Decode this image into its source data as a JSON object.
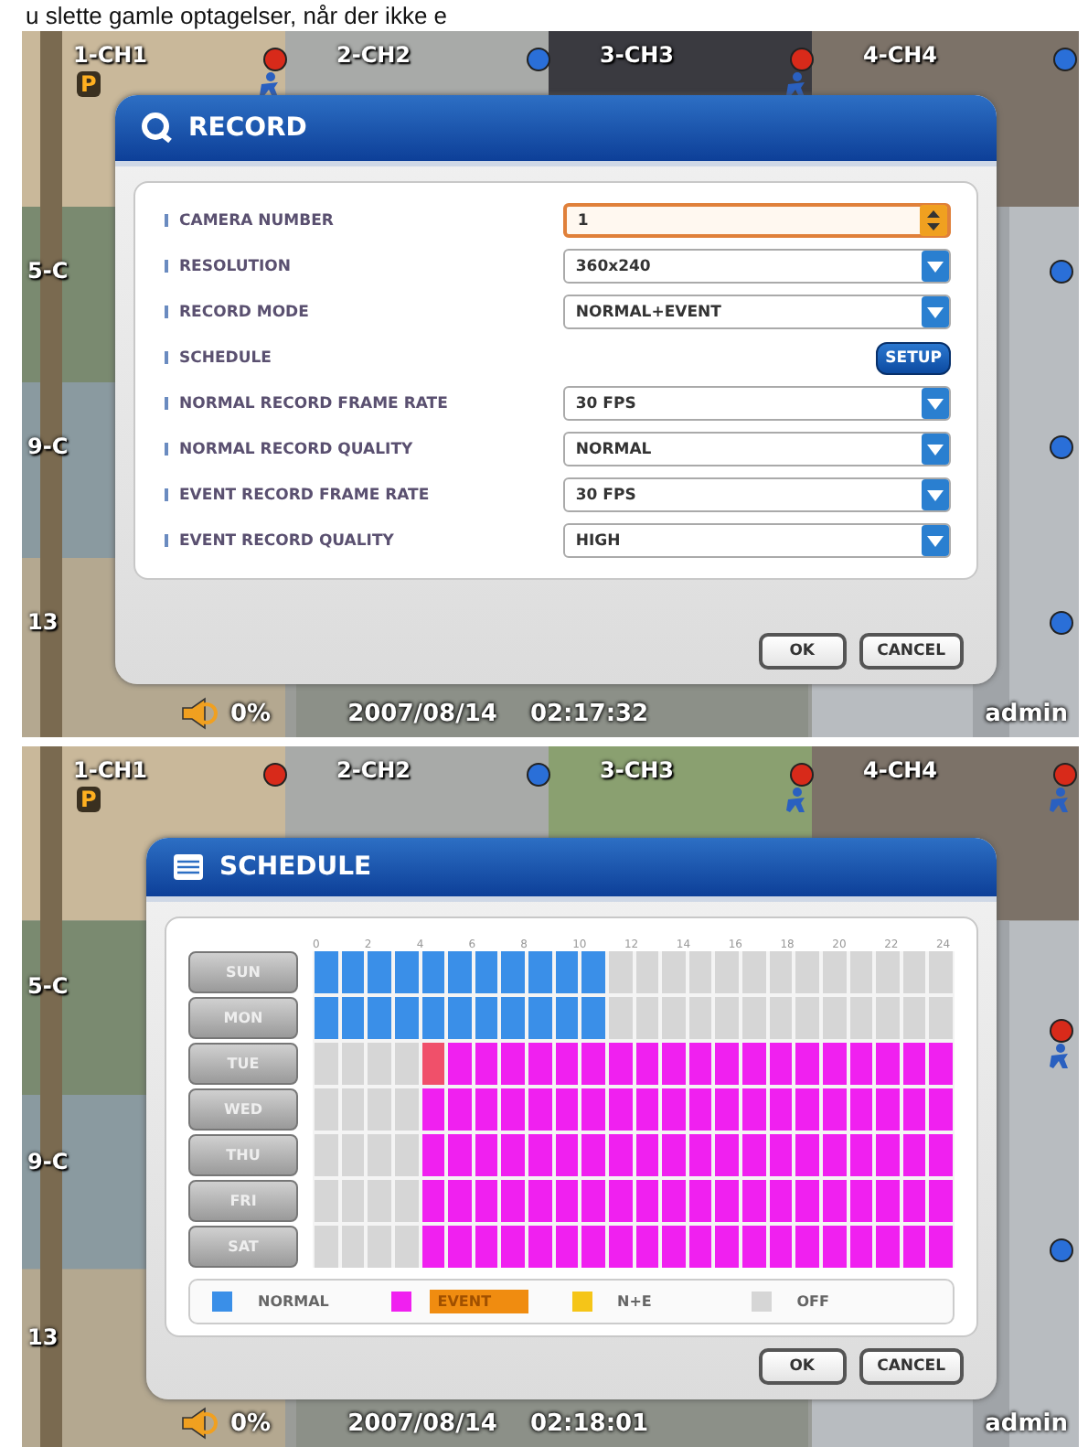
{
  "caption": "u slette gamle optagelser, når der ikke e",
  "screens": [
    {
      "kind": "record",
      "top_row": [
        {
          "label": "1-CH1",
          "badge": "P",
          "color": "#d82a1a",
          "motion": true
        },
        {
          "label": "2-CH2",
          "color": "#2a6fd8",
          "motion": false
        },
        {
          "label": "3-CH3",
          "color": "#d82a1a",
          "motion": true
        },
        {
          "label": "4-CH4",
          "color": "#2a6fd8",
          "motion": false
        }
      ],
      "left_labels": [
        "5-C",
        "9-C",
        "13"
      ],
      "right_dots": [
        {
          "color": "#2a6fd8",
          "motion": false
        },
        {
          "color": "#2a6fd8",
          "motion": false
        },
        {
          "color": "#2a6fd8",
          "motion": false
        }
      ],
      "dialog": {
        "title": "RECORD",
        "rows": [
          {
            "label": "CAMERA NUMBER",
            "kind": "spinner",
            "value": "1",
            "focused": true
          },
          {
            "label": "RESOLUTION",
            "kind": "dropdown",
            "value": "360x240",
            "focused": false
          },
          {
            "label": "RECORD MODE",
            "kind": "dropdown",
            "value": "NORMAL+EVENT",
            "focused": false
          },
          {
            "label": "SCHEDULE",
            "kind": "button",
            "value": "SETUP"
          },
          {
            "label": "NORMAL RECORD FRAME RATE",
            "kind": "dropdown",
            "value": "30 FPS",
            "focused": false
          },
          {
            "label": "NORMAL RECORD QUALITY",
            "kind": "dropdown",
            "value": "NORMAL",
            "focused": false
          },
          {
            "label": "EVENT RECORD FRAME RATE",
            "kind": "dropdown",
            "value": "30 FPS",
            "focused": false
          },
          {
            "label": "EVENT RECORD QUALITY",
            "kind": "dropdown",
            "value": "HIGH",
            "focused": false
          }
        ],
        "buttons": [
          "OK",
          "CANCEL"
        ]
      },
      "status": {
        "volume": "0%",
        "date": "2007/08/14",
        "time": "02:17:32",
        "user": "admin"
      }
    },
    {
      "kind": "schedule",
      "top_row": [
        {
          "label": "1-CH1",
          "badge": "P",
          "color": "#d82a1a",
          "motion": false
        },
        {
          "label": "2-CH2",
          "color": "#2a6fd8",
          "motion": false
        },
        {
          "label": "3-CH3",
          "color": "#d82a1a",
          "motion": true
        },
        {
          "label": "4-CH4",
          "color": "#d82a1a",
          "motion": true
        }
      ],
      "left_labels": [
        "5-C",
        "9-C",
        "13"
      ],
      "right_dots": [
        {
          "color": "#d82a1a",
          "motion": true
        },
        {
          "color": "#2a6fd8",
          "motion": false
        }
      ],
      "dialog": {
        "title": "SCHEDULE",
        "hours": [
          "0",
          "2",
          "4",
          "6",
          "8",
          "10",
          "12",
          "14",
          "16",
          "18",
          "20",
          "22",
          "24"
        ],
        "days": [
          {
            "label": "SUN",
            "cells": [
              {
                "kind": "normal"
              },
              {
                "kind": "normal"
              },
              {
                "kind": "normal"
              },
              {
                "kind": "normal"
              },
              {
                "kind": "normal"
              },
              {
                "kind": "normal"
              },
              {
                "kind": "normal"
              },
              {
                "kind": "normal"
              },
              {
                "kind": "normal"
              },
              {
                "kind": "normal"
              },
              {
                "kind": "normal"
              },
              {
                "kind": "off"
              },
              {
                "kind": "off"
              },
              {
                "kind": "off"
              },
              {
                "kind": "off"
              },
              {
                "kind": "off"
              },
              {
                "kind": "off"
              },
              {
                "kind": "off"
              },
              {
                "kind": "off"
              },
              {
                "kind": "off"
              },
              {
                "kind": "off"
              },
              {
                "kind": "off"
              },
              {
                "kind": "off"
              },
              {
                "kind": "off"
              }
            ]
          },
          {
            "label": "MON",
            "cells": [
              {
                "kind": "normal"
              },
              {
                "kind": "normal"
              },
              {
                "kind": "normal"
              },
              {
                "kind": "normal"
              },
              {
                "kind": "normal"
              },
              {
                "kind": "normal"
              },
              {
                "kind": "normal"
              },
              {
                "kind": "normal"
              },
              {
                "kind": "normal"
              },
              {
                "kind": "normal"
              },
              {
                "kind": "normal"
              },
              {
                "kind": "off"
              },
              {
                "kind": "off"
              },
              {
                "kind": "off"
              },
              {
                "kind": "off"
              },
              {
                "kind": "off"
              },
              {
                "kind": "off"
              },
              {
                "kind": "off"
              },
              {
                "kind": "off"
              },
              {
                "kind": "off"
              },
              {
                "kind": "off"
              },
              {
                "kind": "off"
              },
              {
                "kind": "off"
              },
              {
                "kind": "off"
              }
            ]
          },
          {
            "label": "TUE",
            "cells": [
              {
                "kind": "off"
              },
              {
                "kind": "off"
              },
              {
                "kind": "off"
              },
              {
                "kind": "off"
              },
              {
                "kind": "cursor"
              },
              {
                "kind": "event"
              },
              {
                "kind": "event"
              },
              {
                "kind": "event"
              },
              {
                "kind": "event"
              },
              {
                "kind": "event"
              },
              {
                "kind": "event"
              },
              {
                "kind": "event"
              },
              {
                "kind": "event"
              },
              {
                "kind": "event"
              },
              {
                "kind": "event"
              },
              {
                "kind": "event"
              },
              {
                "kind": "event"
              },
              {
                "kind": "event"
              },
              {
                "kind": "event"
              },
              {
                "kind": "event"
              },
              {
                "kind": "event"
              },
              {
                "kind": "event"
              },
              {
                "kind": "event"
              },
              {
                "kind": "event"
              }
            ]
          },
          {
            "label": "WED",
            "cells": [
              {
                "kind": "off"
              },
              {
                "kind": "off"
              },
              {
                "kind": "off"
              },
              {
                "kind": "off"
              },
              {
                "kind": "event"
              },
              {
                "kind": "event"
              },
              {
                "kind": "event"
              },
              {
                "kind": "event"
              },
              {
                "kind": "event"
              },
              {
                "kind": "event"
              },
              {
                "kind": "event"
              },
              {
                "kind": "event"
              },
              {
                "kind": "event"
              },
              {
                "kind": "event"
              },
              {
                "kind": "event"
              },
              {
                "kind": "event"
              },
              {
                "kind": "event"
              },
              {
                "kind": "event"
              },
              {
                "kind": "event"
              },
              {
                "kind": "event"
              },
              {
                "kind": "event"
              },
              {
                "kind": "event"
              },
              {
                "kind": "event"
              },
              {
                "kind": "event"
              }
            ]
          },
          {
            "label": "THU",
            "cells": [
              {
                "kind": "off"
              },
              {
                "kind": "off"
              },
              {
                "kind": "off"
              },
              {
                "kind": "off"
              },
              {
                "kind": "event"
              },
              {
                "kind": "event"
              },
              {
                "kind": "event"
              },
              {
                "kind": "event"
              },
              {
                "kind": "event"
              },
              {
                "kind": "event"
              },
              {
                "kind": "event"
              },
              {
                "kind": "event"
              },
              {
                "kind": "event"
              },
              {
                "kind": "event"
              },
              {
                "kind": "event"
              },
              {
                "kind": "event"
              },
              {
                "kind": "event"
              },
              {
                "kind": "event"
              },
              {
                "kind": "event"
              },
              {
                "kind": "event"
              },
              {
                "kind": "event"
              },
              {
                "kind": "event"
              },
              {
                "kind": "event"
              },
              {
                "kind": "event"
              }
            ]
          },
          {
            "label": "FRI",
            "cells": [
              {
                "kind": "off"
              },
              {
                "kind": "off"
              },
              {
                "kind": "off"
              },
              {
                "kind": "off"
              },
              {
                "kind": "event"
              },
              {
                "kind": "event"
              },
              {
                "kind": "event"
              },
              {
                "kind": "event"
              },
              {
                "kind": "event"
              },
              {
                "kind": "event"
              },
              {
                "kind": "event"
              },
              {
                "kind": "event"
              },
              {
                "kind": "event"
              },
              {
                "kind": "event"
              },
              {
                "kind": "event"
              },
              {
                "kind": "event"
              },
              {
                "kind": "event"
              },
              {
                "kind": "event"
              },
              {
                "kind": "event"
              },
              {
                "kind": "event"
              },
              {
                "kind": "event"
              },
              {
                "kind": "event"
              },
              {
                "kind": "event"
              },
              {
                "kind": "event"
              }
            ]
          },
          {
            "label": "SAT",
            "cells": [
              {
                "kind": "off"
              },
              {
                "kind": "off"
              },
              {
                "kind": "off"
              },
              {
                "kind": "off"
              },
              {
                "kind": "event"
              },
              {
                "kind": "event"
              },
              {
                "kind": "event"
              },
              {
                "kind": "event"
              },
              {
                "kind": "event"
              },
              {
                "kind": "event"
              },
              {
                "kind": "event"
              },
              {
                "kind": "event"
              },
              {
                "kind": "event"
              },
              {
                "kind": "event"
              },
              {
                "kind": "event"
              },
              {
                "kind": "event"
              },
              {
                "kind": "event"
              },
              {
                "kind": "event"
              },
              {
                "kind": "event"
              },
              {
                "kind": "event"
              },
              {
                "kind": "event"
              },
              {
                "kind": "event"
              },
              {
                "kind": "event"
              },
              {
                "kind": "event"
              }
            ]
          }
        ],
        "legend": [
          {
            "label": "NORMAL",
            "color": "#3a8fe8",
            "selected": false
          },
          {
            "label": "EVENT",
            "color": "#f020f0",
            "selected": true
          },
          {
            "label": "N+E",
            "color": "#f5c518",
            "selected": false
          },
          {
            "label": "OFF",
            "color": "#d6d6d6",
            "selected": false
          }
        ],
        "buttons": [
          "OK",
          "CANCEL"
        ]
      },
      "status": {
        "volume": "0%",
        "date": "2007/08/14",
        "time": "02:18:01",
        "user": "admin"
      }
    }
  ]
}
